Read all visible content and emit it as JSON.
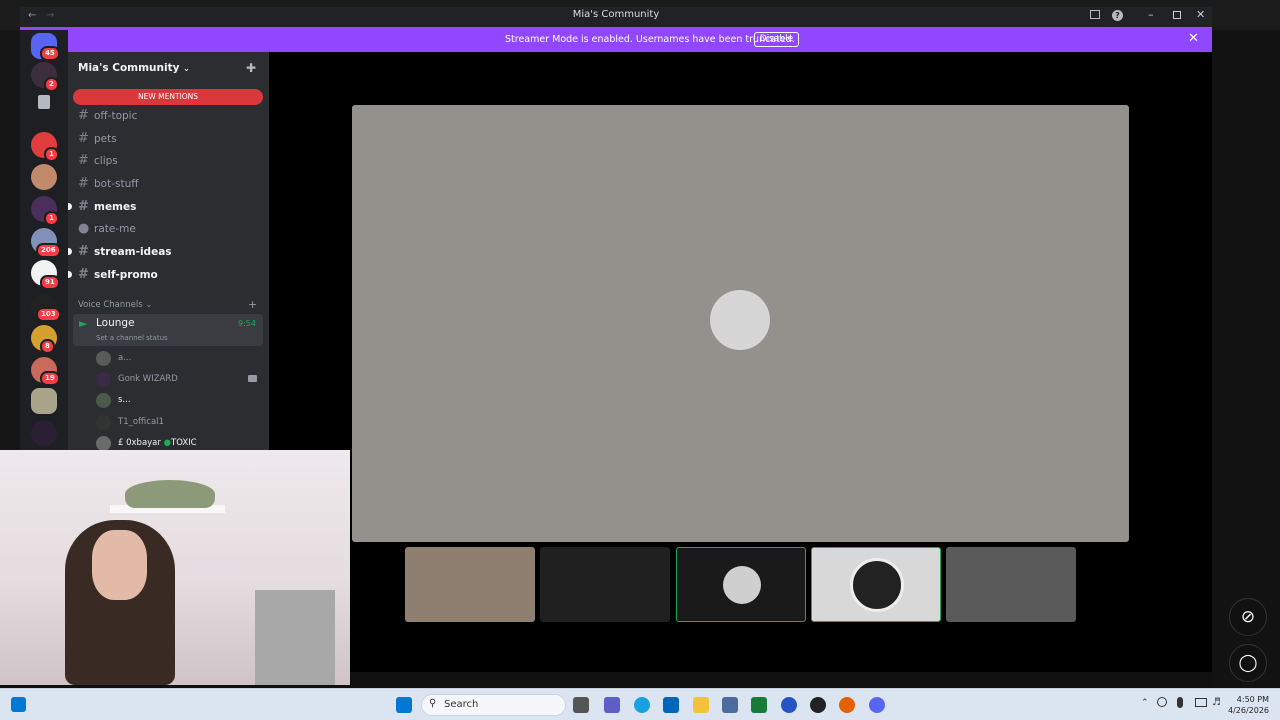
{
  "window": {
    "title": "Mia's Community"
  },
  "banner": {
    "text": "Streamer Mode is enabled. Usernames have been truncated.",
    "disable_label": "Disable",
    "color": "#9147ff"
  },
  "server": {
    "name": "Mia's Community"
  },
  "rail_badges": [
    "45",
    "2",
    "1",
    "1",
    "206",
    "91",
    "103",
    "8",
    "19"
  ],
  "new_mentions": "NEW MENTIONS",
  "channels": [
    {
      "name": "off-topic",
      "unread": false
    },
    {
      "name": "pets",
      "unread": false
    },
    {
      "name": "clips",
      "unread": false
    },
    {
      "name": "bot-stuff",
      "unread": false
    },
    {
      "name": "memes",
      "unread": true
    },
    {
      "name": "rate-me",
      "unread": false
    },
    {
      "name": "stream-ideas",
      "unread": true
    },
    {
      "name": "self-promo",
      "unread": true
    }
  ],
  "voice": {
    "header": "Voice Channels",
    "channel": "Lounge",
    "timer": "9:54",
    "status": "Set a channel status",
    "users": [
      {
        "name": "a..."
      },
      {
        "name": "Gonk WIZARD"
      },
      {
        "name": "s..."
      },
      {
        "name": "T1_offical1"
      },
      {
        "name": "£ 0xbayar",
        "tag": "TOXIC"
      }
    ]
  },
  "taskbar": {
    "search_placeholder": "Search",
    "time": "4:50 PM",
    "date": "4/26/2026"
  }
}
